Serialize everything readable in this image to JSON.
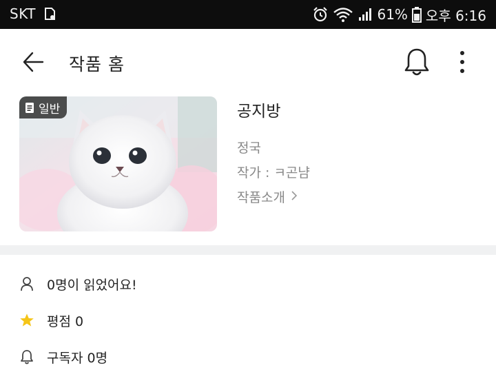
{
  "status_bar": {
    "carrier": "SKT",
    "battery_percent": "61%",
    "time": "오후 6:16"
  },
  "header": {
    "title": "작품 홈"
  },
  "work": {
    "badge": "일반",
    "title": "공지방",
    "genre": "정국",
    "author": "작가 : ㅋ곤냠",
    "intro_link": "작품소개"
  },
  "stats": {
    "readers": "0명이 읽었어요!",
    "rating": "평점 0",
    "subscribers": "구독자 0명"
  },
  "colors": {
    "status_bar_bg": "#0d0d0d",
    "divider": "#f0f1f2",
    "secondary_text": "#888888",
    "star": "#f5c518"
  }
}
